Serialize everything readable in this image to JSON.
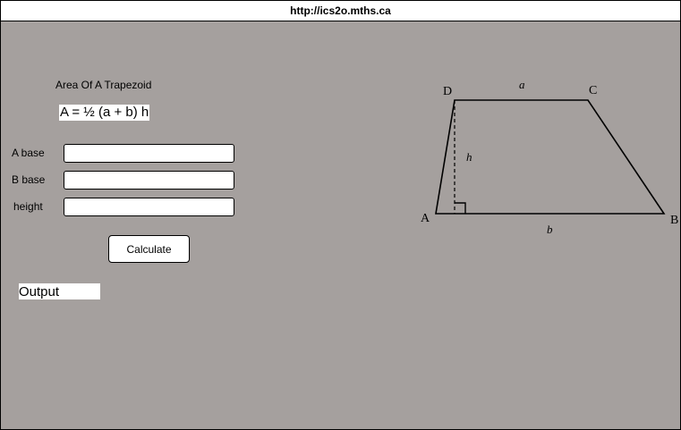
{
  "browser": {
    "url": "http://ics2o.mths.ca"
  },
  "app": {
    "title": "Area Of A Trapezoid",
    "formula": "A = ½ (a + b) h"
  },
  "form": {
    "a_base": {
      "label": "A base",
      "value": ""
    },
    "b_base": {
      "label": "B base",
      "value": ""
    },
    "height": {
      "label": "height",
      "value": ""
    },
    "calculate_label": "Calculate"
  },
  "output": {
    "text": "Output"
  },
  "diagram": {
    "vertex_a": "A",
    "vertex_b": "B",
    "vertex_c": "C",
    "vertex_d": "D",
    "side_a": "a",
    "side_b": "b",
    "height_label": "h"
  }
}
